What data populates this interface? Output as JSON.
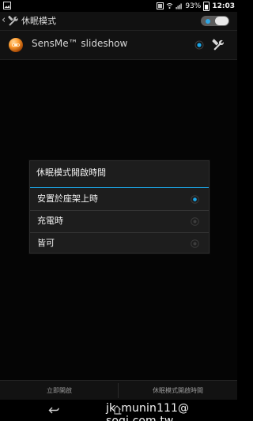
{
  "status_bar": {
    "battery_percent": "93%",
    "time": "12:03"
  },
  "action_bar": {
    "title": "休眠模式",
    "toggle_state": "on"
  },
  "list": {
    "item_label": "SensMe™ slideshow"
  },
  "dialog": {
    "title": "休眠模式開啟時間",
    "options": [
      {
        "label": "安置於座架上時",
        "selected": true
      },
      {
        "label": "充電時",
        "selected": false
      },
      {
        "label": "皆可",
        "selected": false
      }
    ]
  },
  "bottom_buttons": {
    "left": "立即開啟",
    "right": "休眠模式開啟時間"
  },
  "watermark": "jk_munin111@ sogi.com.tw",
  "colors": {
    "accent": "#1ca7e8",
    "background": "#050505"
  },
  "icons": {
    "status_left": "image-icon",
    "settings": "tools-icon",
    "sensme": "sensme-icon",
    "back": "back-icon",
    "home": "home-icon"
  }
}
